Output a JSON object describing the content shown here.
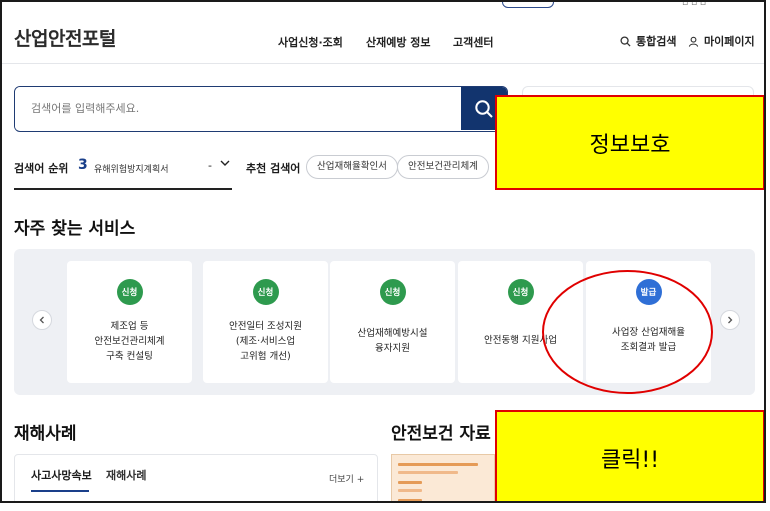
{
  "header": {
    "logo": "산업안전포털",
    "nav": [
      "사업신청·조회",
      "산재예방 정보",
      "고객센터"
    ],
    "util_search": "통합검색",
    "util_mypage": "마이페이지"
  },
  "search": {
    "placeholder": "검색어를 입력해주세요.",
    "button_icon": "search-icon"
  },
  "ranking": {
    "label": "검색어 순위",
    "number": "3",
    "keyword": "유해위험방지계획서",
    "dash": "-"
  },
  "recommended": {
    "label": "추천 검색어",
    "chips": [
      "산업재해율확인서",
      "안전보건관리체계"
    ]
  },
  "services": {
    "title": "자주 찾는 서비스",
    "cards": [
      {
        "badge": "신청",
        "badge_color": "#2e9a4e",
        "lines": [
          "제조업 등",
          "안전보건관리체계",
          "구축 컨설팅"
        ]
      },
      {
        "badge": "신청",
        "badge_color": "#2e9a4e",
        "lines": [
          "안전일터 조성지원",
          "(제조·서비스업",
          "고위험 개선)"
        ]
      },
      {
        "badge": "신청",
        "badge_color": "#2e9a4e",
        "lines": [
          "산업재해예방시설",
          "융자지원"
        ]
      },
      {
        "badge": "신청",
        "badge_color": "#2e9a4e",
        "lines": [
          "안전동행 지원사업"
        ]
      },
      {
        "badge": "발급",
        "badge_color": "#2f6fd6",
        "lines": [
          "사업장 산업재해율",
          "조회결과 발급"
        ]
      }
    ]
  },
  "annotations": {
    "top": "정보보호",
    "bottom": "클릭!!",
    "accent": "#e00000",
    "fill": "#ffff00"
  },
  "cases": {
    "title": "재해사례",
    "tabs": [
      "사고사망속보",
      "재해사례"
    ],
    "more": "더보기 +"
  },
  "resources": {
    "title": "안전보건 자료"
  },
  "colors": {
    "brand_navy": "#12346e",
    "rank_blue": "#1a3f8a",
    "panel_bg": "#eef0f4"
  }
}
